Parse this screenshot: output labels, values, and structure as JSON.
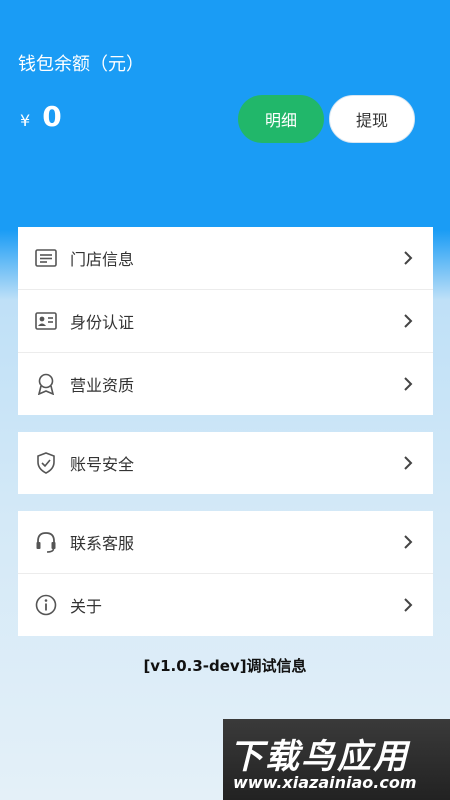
{
  "header": {
    "balance_title": "钱包余额（元）",
    "currency_symbol": "¥",
    "balance": "0",
    "detail_button": "明细",
    "withdraw_button": "提现"
  },
  "menu": {
    "store_info": "门店信息",
    "identity_verification": "身份认证",
    "business_qualification": "营业资质",
    "account_security": "账号安全",
    "customer_service": "联系客服",
    "about": "关于"
  },
  "debug_text": "[v1.0.3-dev]调试信息",
  "watermark": {
    "title": "下载鸟应用",
    "url": "www.xiazainiao.com"
  },
  "colors": {
    "header_blue": "#1a9cf5",
    "detail_green": "#21b76a"
  }
}
